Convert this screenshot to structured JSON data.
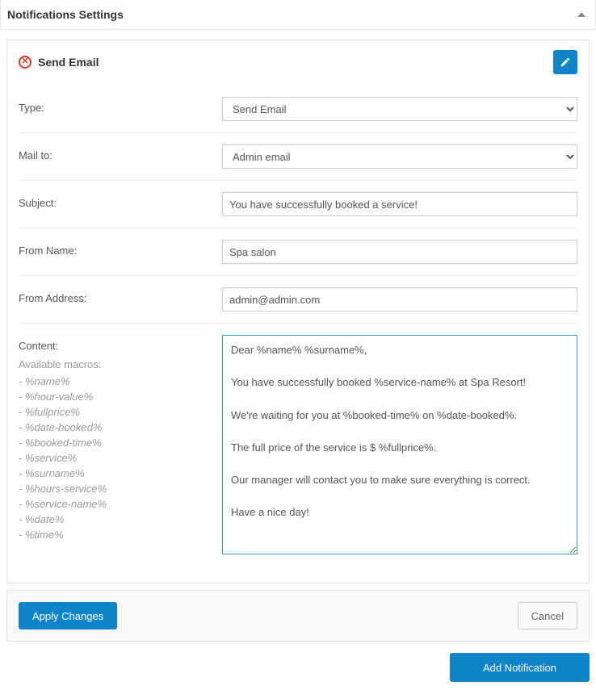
{
  "panel": {
    "title": "Notifications Settings"
  },
  "card": {
    "title": "Send Email"
  },
  "form": {
    "type": {
      "label": "Type:",
      "value": "Send Email"
    },
    "mail_to": {
      "label": "Mail to:",
      "value": "Admin email"
    },
    "subject": {
      "label": "Subject:",
      "value": "You have successfully booked a service!"
    },
    "from_name": {
      "label": "From Name:",
      "value": "Spa salon"
    },
    "from_address": {
      "label": "From Address:",
      "value": "admin@admin.com"
    },
    "content": {
      "label": "Content:",
      "macros_title": "Available macros:",
      "macros": [
        "%name%",
        "%hour-value%",
        "%fullprice%",
        "%date-booked%",
        "%booked-time%",
        "%service%",
        "%surname%",
        "%hours-service%",
        "%service-name%",
        "%date%",
        "%time%"
      ],
      "value": "Dear %name% %surname%,\n\nYou have successfully booked %service-name% at Spa Resort!\n\nWe're waiting for you at %booked-time% on %date-booked%.\n\nThe full price of the service is $ %fullprice%.\n\nOur manager will contact you to make sure everything is correct.\n\nHave a nice day!"
    }
  },
  "buttons": {
    "apply": "Apply Changes",
    "cancel": "Cancel",
    "add": "Add Notification"
  }
}
